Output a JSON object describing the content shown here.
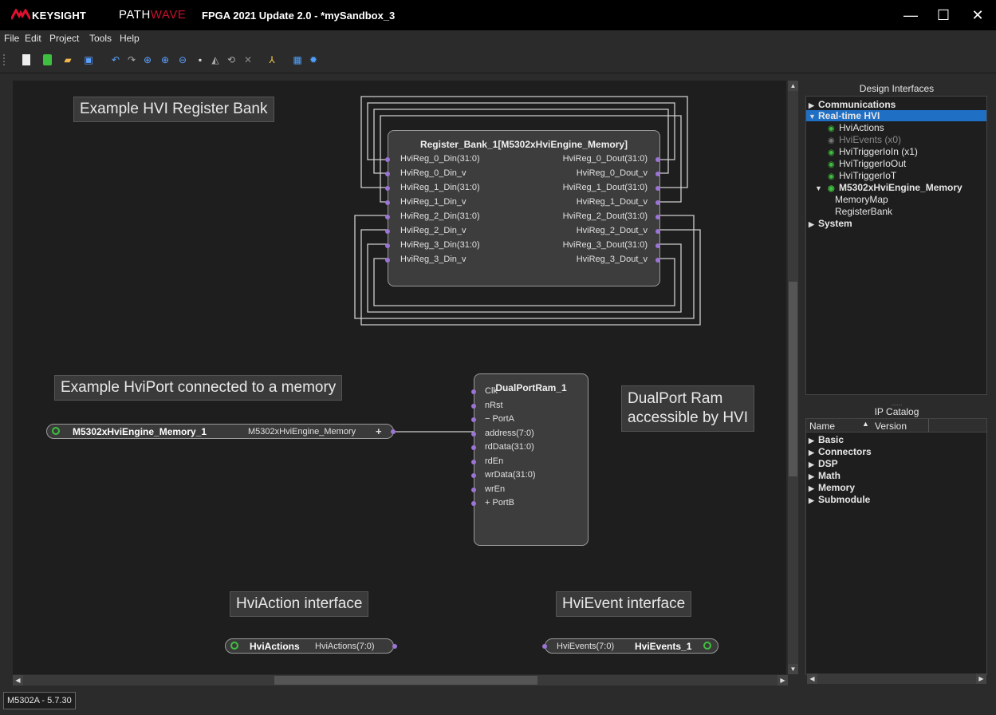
{
  "titlebar": {
    "brand": "KEYSIGHT",
    "product_left": "PATH",
    "product_right": "WAVE",
    "title": "FPGA 2021 Update 2.0 - *mySandbox_3",
    "minimize": "—",
    "maximize": "☐",
    "close": "✕"
  },
  "menu": [
    "File",
    "Edit",
    "Project",
    "Tools",
    "Help"
  ],
  "toolbar_icons": [
    "new-file-icon",
    "new-project-icon",
    "open-folder-icon",
    "save-icon",
    "undo-icon",
    "redo-icon",
    "zoom-fit-icon",
    "zoom-in-icon",
    "zoom-out-icon",
    "copy-icon",
    "flip-icon",
    "refresh-icon",
    "delete-icon",
    "route-icon",
    "chip-icon",
    "settings-icon"
  ],
  "canvas": {
    "notes": {
      "register_bank": "Example HVI Register Bank",
      "hviport": "Example HviPort connected to a memory",
      "dualport_line1": "DualPort Ram",
      "dualport_line2": "accessible by HVI",
      "hviaction": "HviAction interface",
      "hvievent": "HviEvent interface"
    },
    "register_bank": {
      "title": "Register_Bank_1[M5302xHviEngine_Memory]",
      "inputs": [
        "HviReg_0_Din(31:0)",
        "HviReg_0_Din_v",
        "HviReg_1_Din(31:0)",
        "HviReg_1_Din_v",
        "HviReg_2_Din(31:0)",
        "HviReg_2_Din_v",
        "HviReg_3_Din(31:0)",
        "HviReg_3_Din_v"
      ],
      "outputs": [
        "HviReg_0_Dout(31:0)",
        "HviReg_0_Dout_v",
        "HviReg_1_Dout(31:0)",
        "HviReg_1_Dout_v",
        "HviReg_2_Dout(31:0)",
        "HviReg_2_Dout_v",
        "HviReg_3_Dout(31:0)",
        "HviReg_3_Dout_v"
      ]
    },
    "dualport": {
      "title": "DualPortRam_1",
      "ports": [
        "Clk",
        "nRst",
        "− PortA",
        "address(7:0)",
        "rdData(31:0)",
        "rdEn",
        "wrData(31:0)",
        "wrEn",
        "+ PortB"
      ]
    },
    "memory_port": {
      "name": "M5302xHviEngine_Memory_1",
      "type": "M5302xHviEngine_Memory",
      "expand": "+"
    },
    "hviactions": {
      "name": "HviActions",
      "type": "HviActions(7:0)"
    },
    "hvievents": {
      "name": "HviEvents_1",
      "type": "HviEvents(7:0)"
    }
  },
  "design_interfaces": {
    "header": "Design Interfaces",
    "items": [
      {
        "label": "Communications",
        "bold": true
      },
      {
        "label": "Real-time HVI",
        "bold": true
      },
      {
        "label": "HviActions"
      },
      {
        "label": "HviEvents (x0)"
      },
      {
        "label": "HviTriggerIoIn (x1)"
      },
      {
        "label": "HviTriggerIoOut"
      },
      {
        "label": "HviTriggerIoT"
      },
      {
        "label": "M5302xHviEngine_Memory",
        "bold": true
      },
      {
        "label": "MemoryMap"
      },
      {
        "label": "RegisterBank"
      },
      {
        "label": "System",
        "bold": true
      }
    ]
  },
  "ip_catalog": {
    "header": "IP Catalog",
    "col_name": "Name",
    "col_version": "Version",
    "items": [
      "Basic",
      "Connectors",
      "DSP",
      "Math",
      "Memory",
      "Submodule"
    ]
  },
  "status": {
    "version": "M5302A - 5.7.30"
  },
  "colors": {
    "accent": "#1f6fc5",
    "port": "#9b74d6",
    "interface_green": "#3fbf3f",
    "brand_red": "#c8102e"
  }
}
